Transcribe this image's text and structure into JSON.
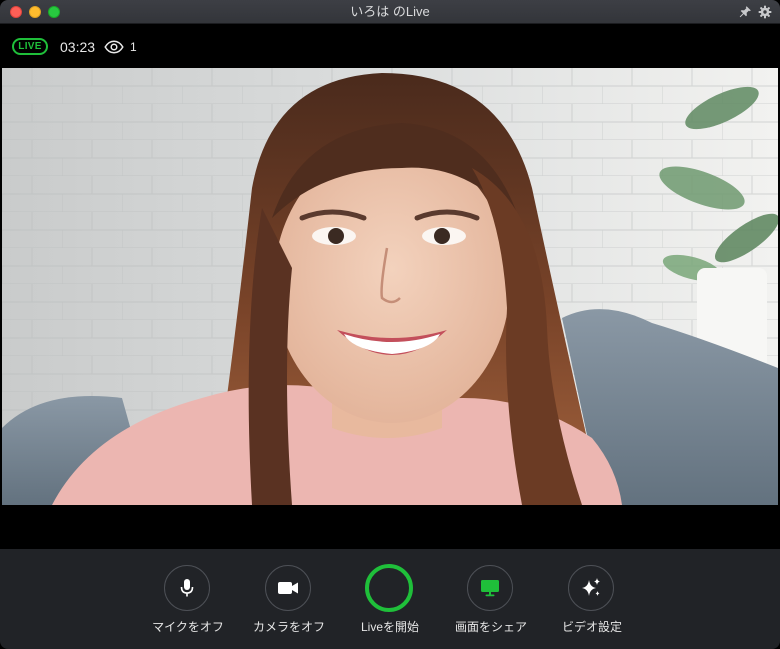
{
  "window": {
    "title": "いろは のLive"
  },
  "status": {
    "live_label": "LIVE",
    "timer": "03:23",
    "viewer_count": "1"
  },
  "controls": [
    {
      "id": "mic",
      "label": "マイクをオフ",
      "icon": "microphone-icon"
    },
    {
      "id": "camera",
      "label": "カメラをオフ",
      "icon": "video-camera-icon"
    },
    {
      "id": "start",
      "label": "Liveを開始",
      "icon": "start-live-ring"
    },
    {
      "id": "share",
      "label": "画面をシェア",
      "icon": "monitor-icon"
    },
    {
      "id": "settings",
      "label": "ビデオ設定",
      "icon": "sparkle-icon"
    }
  ],
  "colors": {
    "accent": "#1fbf3a",
    "toolbar": "#212327",
    "share_icon": "#1fbf3a"
  }
}
